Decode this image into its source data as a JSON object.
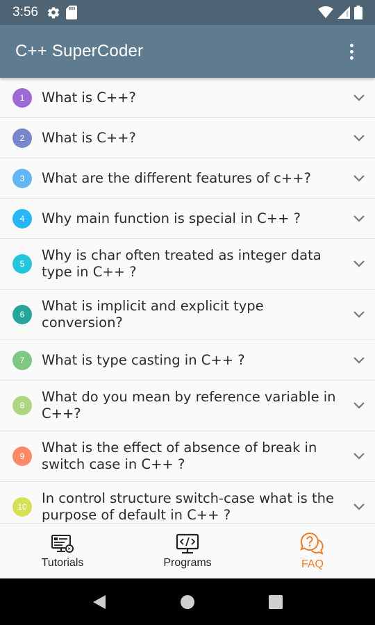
{
  "status_bar": {
    "time": "3:56",
    "left_icons": [
      "settings-icon",
      "sd-card-icon"
    ],
    "right_icons": [
      "wifi-icon",
      "signal-icon",
      "battery-icon"
    ]
  },
  "app_bar": {
    "title": "C++ SuperCoder",
    "menu_icon": "overflow-menu-icon"
  },
  "colors": {
    "status_bar": "#4e6474",
    "app_bar": "#5f7b8f",
    "active_nav": "#ef7b22"
  },
  "faq": [
    {
      "num": "1",
      "question": "What is C++?",
      "color": "#9c6ad4"
    },
    {
      "num": "2",
      "question": "What is C++?",
      "color": "#7986cb"
    },
    {
      "num": "3",
      "question": "What are the different features of c++?",
      "color": "#64b5f6"
    },
    {
      "num": "4",
      "question": "Why main function is special in C++ ?",
      "color": "#29b6f6"
    },
    {
      "num": "5",
      "question": "Why is char often treated as integer data type in C++ ?",
      "color": "#26c6da"
    },
    {
      "num": "6",
      "question": "What is implicit and explicit type conversion?",
      "color": "#26a69a"
    },
    {
      "num": "7",
      "question": "What is type casting in C++ ?",
      "color": "#81c784"
    },
    {
      "num": "8",
      "question": "What do you mean by reference variable in C++?",
      "color": "#aed581"
    },
    {
      "num": "9",
      "question": "What is the effect of absence of break in switch case in C++ ?",
      "color": "#ff8a65"
    },
    {
      "num": "10",
      "question": "In control structure switch-case what is the purpose of default in C++ ?",
      "color": "#d4e157"
    }
  ],
  "bottom_nav": {
    "tutorials": {
      "label": "Tutorials",
      "icon": "tutorials-icon"
    },
    "programs": {
      "label": "Programs",
      "icon": "programs-icon"
    },
    "faq": {
      "label": "FAQ",
      "icon": "faq-icon",
      "active": true
    }
  },
  "system_nav": [
    "back-icon",
    "home-icon",
    "recents-icon"
  ]
}
